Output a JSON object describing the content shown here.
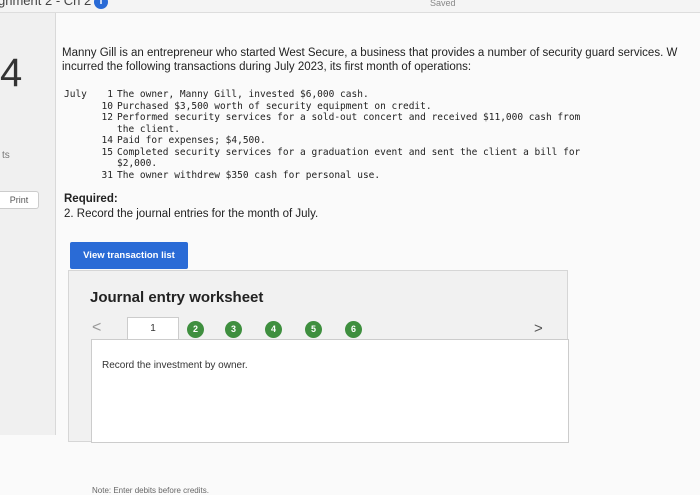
{
  "header": {
    "assignment_title": "gnment 2 - Ch 2",
    "info_icon": "i",
    "saved_label": "Saved"
  },
  "sidebar": {
    "question_number": "4",
    "points_fragment": "ts",
    "print_label": "Print"
  },
  "problem": {
    "intro_line1": "Manny Gill is an entrepreneur who started West Secure, a business that provides a number of security guard services. W",
    "intro_line2": "incurred the following transactions during July 2023, its first month of operations:",
    "transactions": [
      {
        "month": "July",
        "day": "1",
        "text": "The owner, Manny Gill, invested $6,000 cash."
      },
      {
        "month": "",
        "day": "10",
        "text": "Purchased $3,500 worth of security equipment on credit."
      },
      {
        "month": "",
        "day": "12",
        "text": "Performed security services for a sold-out concert and received $11,000 cash from\nthe client."
      },
      {
        "month": "",
        "day": "14",
        "text": "Paid for expenses; $4,500."
      },
      {
        "month": "",
        "day": "15",
        "text": "Completed security services for a graduation event and sent the client a bill for\n$2,000."
      },
      {
        "month": "",
        "day": "31",
        "text": "The owner withdrew $350 cash for personal use."
      }
    ],
    "required_label": "Required:",
    "required_text": "2. Record the journal entries for the month of July."
  },
  "buttons": {
    "view_transaction_list": "View transaction list"
  },
  "worksheet": {
    "title": "Journal entry worksheet",
    "prev_arrow": "<",
    "next_arrow": ">",
    "current_page": "1",
    "steps": [
      "2",
      "3",
      "4",
      "5",
      "6"
    ],
    "step_color": "#3f8f3f",
    "instruction": "Record the investment by owner.",
    "note": "Note: Enter debits before credits."
  },
  "colors": {
    "accent_blue": "#2a6bd6"
  }
}
